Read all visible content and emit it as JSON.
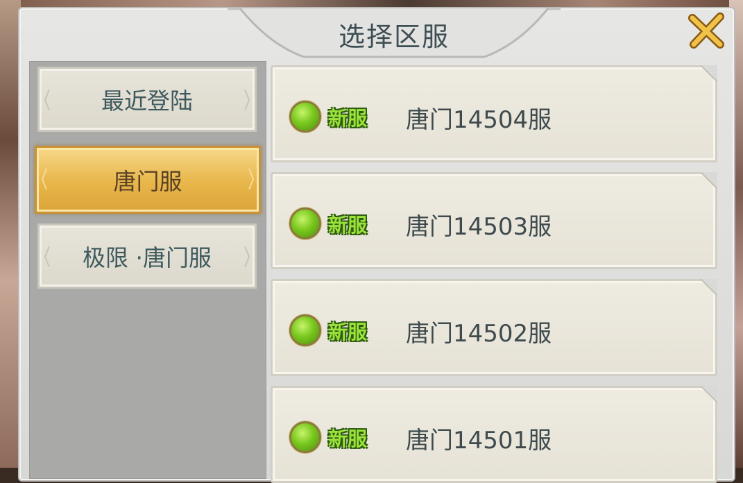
{
  "dialog": {
    "title": "选择区服",
    "close_icon": "close-x-icon",
    "accent_color": "#e8b64a"
  },
  "tabs": [
    {
      "label": "最近登陆",
      "active": false
    },
    {
      "label": "唐门服",
      "active": true
    },
    {
      "label": "极限 ·唐门服",
      "active": false
    }
  ],
  "servers": [
    {
      "status": "online",
      "badge": "新服",
      "name": "唐门14504服"
    },
    {
      "status": "online",
      "badge": "新服",
      "name": "唐门14503服"
    },
    {
      "status": "online",
      "badge": "新服",
      "name": "唐门14502服"
    },
    {
      "status": "online",
      "badge": "新服",
      "name": "唐门14501服"
    }
  ]
}
